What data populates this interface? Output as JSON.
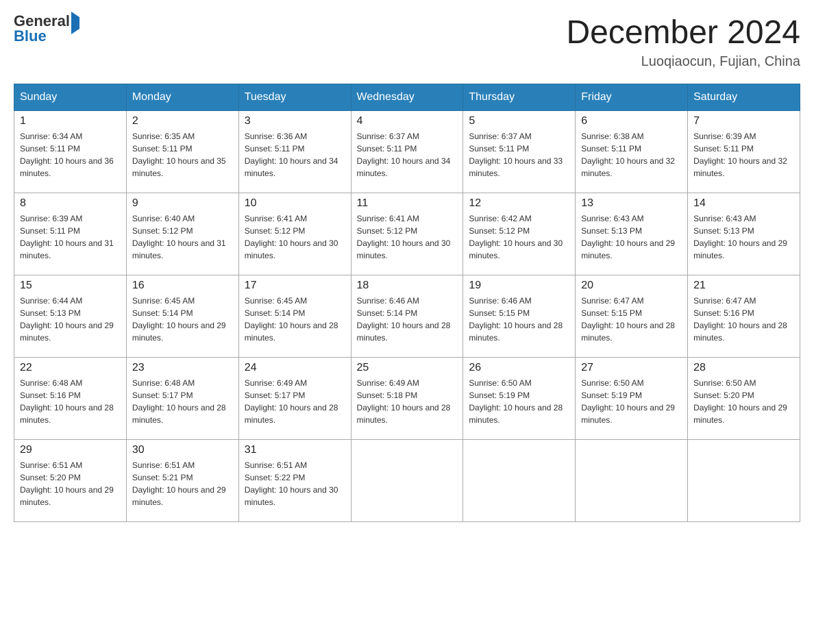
{
  "header": {
    "logo_general": "General",
    "logo_blue": "Blue",
    "month_title": "December 2024",
    "location": "Luoqiaocun, Fujian, China"
  },
  "days_of_week": [
    "Sunday",
    "Monday",
    "Tuesday",
    "Wednesday",
    "Thursday",
    "Friday",
    "Saturday"
  ],
  "weeks": [
    [
      {
        "day": "1",
        "sunrise": "Sunrise: 6:34 AM",
        "sunset": "Sunset: 5:11 PM",
        "daylight": "Daylight: 10 hours and 36 minutes."
      },
      {
        "day": "2",
        "sunrise": "Sunrise: 6:35 AM",
        "sunset": "Sunset: 5:11 PM",
        "daylight": "Daylight: 10 hours and 35 minutes."
      },
      {
        "day": "3",
        "sunrise": "Sunrise: 6:36 AM",
        "sunset": "Sunset: 5:11 PM",
        "daylight": "Daylight: 10 hours and 34 minutes."
      },
      {
        "day": "4",
        "sunrise": "Sunrise: 6:37 AM",
        "sunset": "Sunset: 5:11 PM",
        "daylight": "Daylight: 10 hours and 34 minutes."
      },
      {
        "day": "5",
        "sunrise": "Sunrise: 6:37 AM",
        "sunset": "Sunset: 5:11 PM",
        "daylight": "Daylight: 10 hours and 33 minutes."
      },
      {
        "day": "6",
        "sunrise": "Sunrise: 6:38 AM",
        "sunset": "Sunset: 5:11 PM",
        "daylight": "Daylight: 10 hours and 32 minutes."
      },
      {
        "day": "7",
        "sunrise": "Sunrise: 6:39 AM",
        "sunset": "Sunset: 5:11 PM",
        "daylight": "Daylight: 10 hours and 32 minutes."
      }
    ],
    [
      {
        "day": "8",
        "sunrise": "Sunrise: 6:39 AM",
        "sunset": "Sunset: 5:11 PM",
        "daylight": "Daylight: 10 hours and 31 minutes."
      },
      {
        "day": "9",
        "sunrise": "Sunrise: 6:40 AM",
        "sunset": "Sunset: 5:12 PM",
        "daylight": "Daylight: 10 hours and 31 minutes."
      },
      {
        "day": "10",
        "sunrise": "Sunrise: 6:41 AM",
        "sunset": "Sunset: 5:12 PM",
        "daylight": "Daylight: 10 hours and 30 minutes."
      },
      {
        "day": "11",
        "sunrise": "Sunrise: 6:41 AM",
        "sunset": "Sunset: 5:12 PM",
        "daylight": "Daylight: 10 hours and 30 minutes."
      },
      {
        "day": "12",
        "sunrise": "Sunrise: 6:42 AM",
        "sunset": "Sunset: 5:12 PM",
        "daylight": "Daylight: 10 hours and 30 minutes."
      },
      {
        "day": "13",
        "sunrise": "Sunrise: 6:43 AM",
        "sunset": "Sunset: 5:13 PM",
        "daylight": "Daylight: 10 hours and 29 minutes."
      },
      {
        "day": "14",
        "sunrise": "Sunrise: 6:43 AM",
        "sunset": "Sunset: 5:13 PM",
        "daylight": "Daylight: 10 hours and 29 minutes."
      }
    ],
    [
      {
        "day": "15",
        "sunrise": "Sunrise: 6:44 AM",
        "sunset": "Sunset: 5:13 PM",
        "daylight": "Daylight: 10 hours and 29 minutes."
      },
      {
        "day": "16",
        "sunrise": "Sunrise: 6:45 AM",
        "sunset": "Sunset: 5:14 PM",
        "daylight": "Daylight: 10 hours and 29 minutes."
      },
      {
        "day": "17",
        "sunrise": "Sunrise: 6:45 AM",
        "sunset": "Sunset: 5:14 PM",
        "daylight": "Daylight: 10 hours and 28 minutes."
      },
      {
        "day": "18",
        "sunrise": "Sunrise: 6:46 AM",
        "sunset": "Sunset: 5:14 PM",
        "daylight": "Daylight: 10 hours and 28 minutes."
      },
      {
        "day": "19",
        "sunrise": "Sunrise: 6:46 AM",
        "sunset": "Sunset: 5:15 PM",
        "daylight": "Daylight: 10 hours and 28 minutes."
      },
      {
        "day": "20",
        "sunrise": "Sunrise: 6:47 AM",
        "sunset": "Sunset: 5:15 PM",
        "daylight": "Daylight: 10 hours and 28 minutes."
      },
      {
        "day": "21",
        "sunrise": "Sunrise: 6:47 AM",
        "sunset": "Sunset: 5:16 PM",
        "daylight": "Daylight: 10 hours and 28 minutes."
      }
    ],
    [
      {
        "day": "22",
        "sunrise": "Sunrise: 6:48 AM",
        "sunset": "Sunset: 5:16 PM",
        "daylight": "Daylight: 10 hours and 28 minutes."
      },
      {
        "day": "23",
        "sunrise": "Sunrise: 6:48 AM",
        "sunset": "Sunset: 5:17 PM",
        "daylight": "Daylight: 10 hours and 28 minutes."
      },
      {
        "day": "24",
        "sunrise": "Sunrise: 6:49 AM",
        "sunset": "Sunset: 5:17 PM",
        "daylight": "Daylight: 10 hours and 28 minutes."
      },
      {
        "day": "25",
        "sunrise": "Sunrise: 6:49 AM",
        "sunset": "Sunset: 5:18 PM",
        "daylight": "Daylight: 10 hours and 28 minutes."
      },
      {
        "day": "26",
        "sunrise": "Sunrise: 6:50 AM",
        "sunset": "Sunset: 5:19 PM",
        "daylight": "Daylight: 10 hours and 28 minutes."
      },
      {
        "day": "27",
        "sunrise": "Sunrise: 6:50 AM",
        "sunset": "Sunset: 5:19 PM",
        "daylight": "Daylight: 10 hours and 29 minutes."
      },
      {
        "day": "28",
        "sunrise": "Sunrise: 6:50 AM",
        "sunset": "Sunset: 5:20 PM",
        "daylight": "Daylight: 10 hours and 29 minutes."
      }
    ],
    [
      {
        "day": "29",
        "sunrise": "Sunrise: 6:51 AM",
        "sunset": "Sunset: 5:20 PM",
        "daylight": "Daylight: 10 hours and 29 minutes."
      },
      {
        "day": "30",
        "sunrise": "Sunrise: 6:51 AM",
        "sunset": "Sunset: 5:21 PM",
        "daylight": "Daylight: 10 hours and 29 minutes."
      },
      {
        "day": "31",
        "sunrise": "Sunrise: 6:51 AM",
        "sunset": "Sunset: 5:22 PM",
        "daylight": "Daylight: 10 hours and 30 minutes."
      },
      null,
      null,
      null,
      null
    ]
  ]
}
